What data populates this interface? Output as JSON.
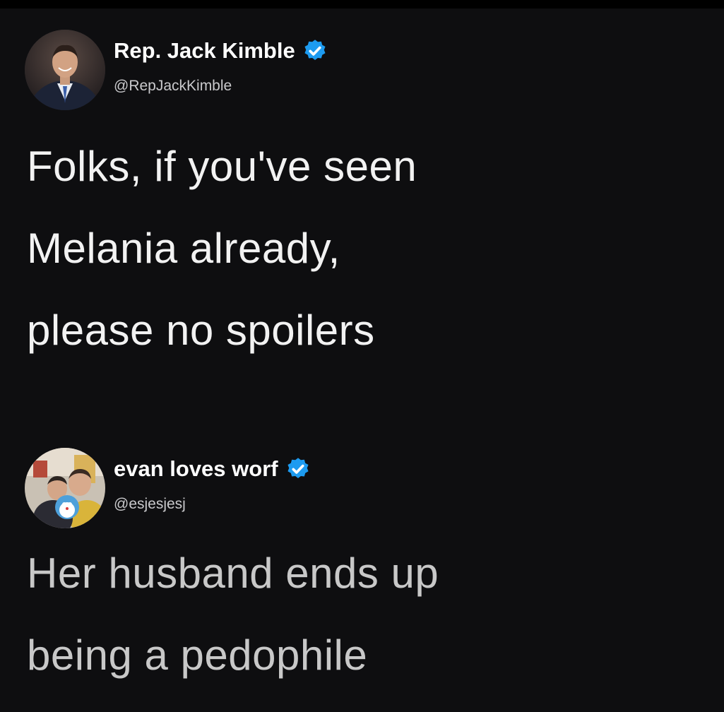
{
  "tweets": [
    {
      "display_name": "Rep. Jack Kimble",
      "handle": "@RepJackKimble",
      "verified": true,
      "avatar_icon": "man-in-suit-avatar",
      "body_lines": [
        "Folks, if you've seen",
        "Melania already,",
        "please no spoilers"
      ]
    },
    {
      "display_name": "evan loves worf",
      "handle": "@esjesjesj",
      "verified": true,
      "avatar_icon": "selfie-with-toy-avatar",
      "body_lines": [
        "Her husband ends up",
        "being a pedophile"
      ]
    }
  ],
  "colors": {
    "background": "#0e0e10",
    "verified_badge": "#1d9bf0",
    "primary_text": "#ffffff",
    "secondary_text": "#c9c9cc"
  }
}
